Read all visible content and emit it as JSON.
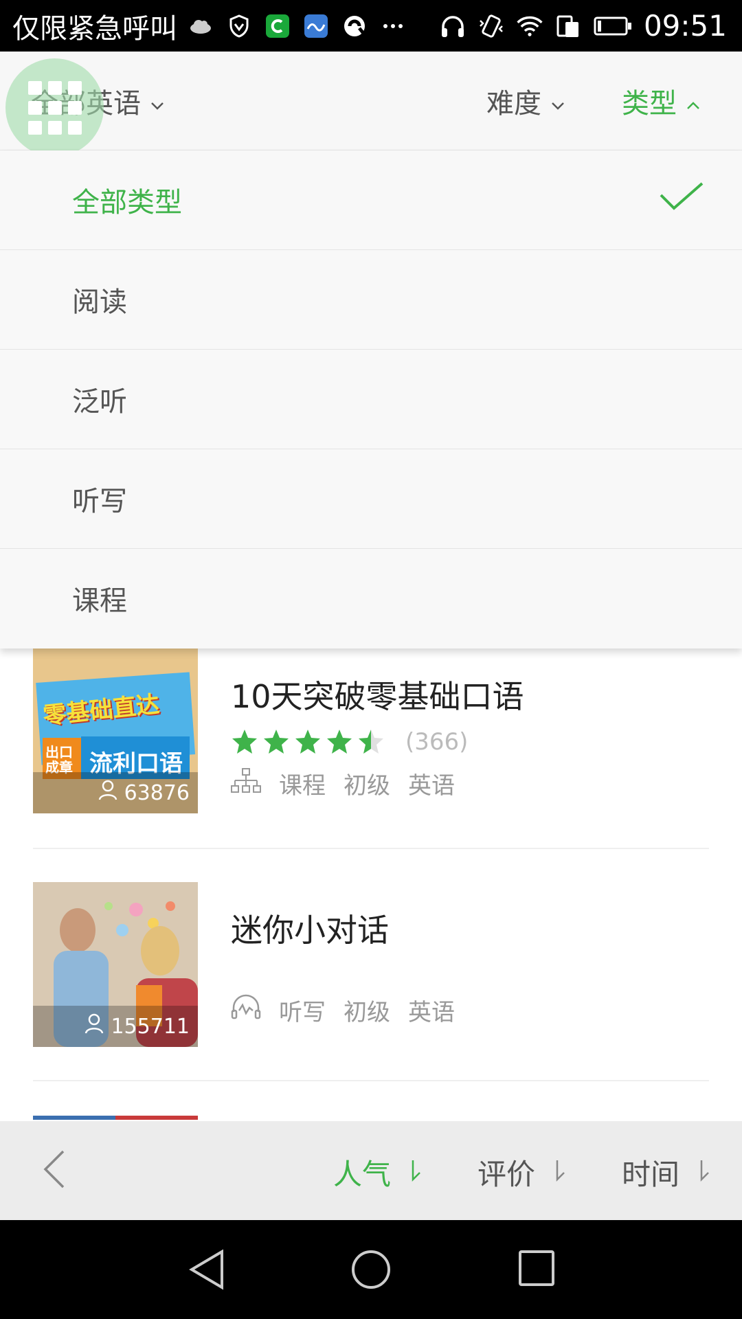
{
  "status_bar": {
    "carrier_text": "仅限紧急呼叫",
    "time": "09:51",
    "icons": [
      "weather-cloud-icon",
      "shield-icon",
      "green-app-icon",
      "blue-app-icon",
      "sync-icon",
      "more-dots-icon",
      "headset-icon",
      "vibrate-icon",
      "wifi-icon",
      "dual-sim-icon",
      "battery-icon"
    ]
  },
  "filter_bar": {
    "all_label": "全部英语",
    "difficulty_label": "难度",
    "type_label": "类型"
  },
  "type_dropdown": {
    "items": [
      {
        "label": "全部类型",
        "selected": true
      },
      {
        "label": "阅读",
        "selected": false
      },
      {
        "label": "泛听",
        "selected": false
      },
      {
        "label": "听写",
        "selected": false
      },
      {
        "label": "课程",
        "selected": false
      }
    ]
  },
  "courses": [
    {
      "title": "10天突破零基础口语",
      "learners": "63876",
      "rating": 4.5,
      "rating_count": "(366)",
      "type": "课程",
      "level": "初级",
      "language": "英语",
      "thumb_text_top": "零基础直达",
      "thumb_text_bottom": "出口成章",
      "thumb_text_bottom2": "流利口语"
    },
    {
      "title": "迷你小对话",
      "learners": "155711",
      "type": "听写",
      "level": "初级",
      "language": "英语"
    }
  ],
  "sort_bar": {
    "popularity_label": "人气",
    "rating_label": "评价",
    "time_label": "时间"
  },
  "colors": {
    "accent": "#3fb34a",
    "text": "#555555",
    "muted": "#999999"
  }
}
